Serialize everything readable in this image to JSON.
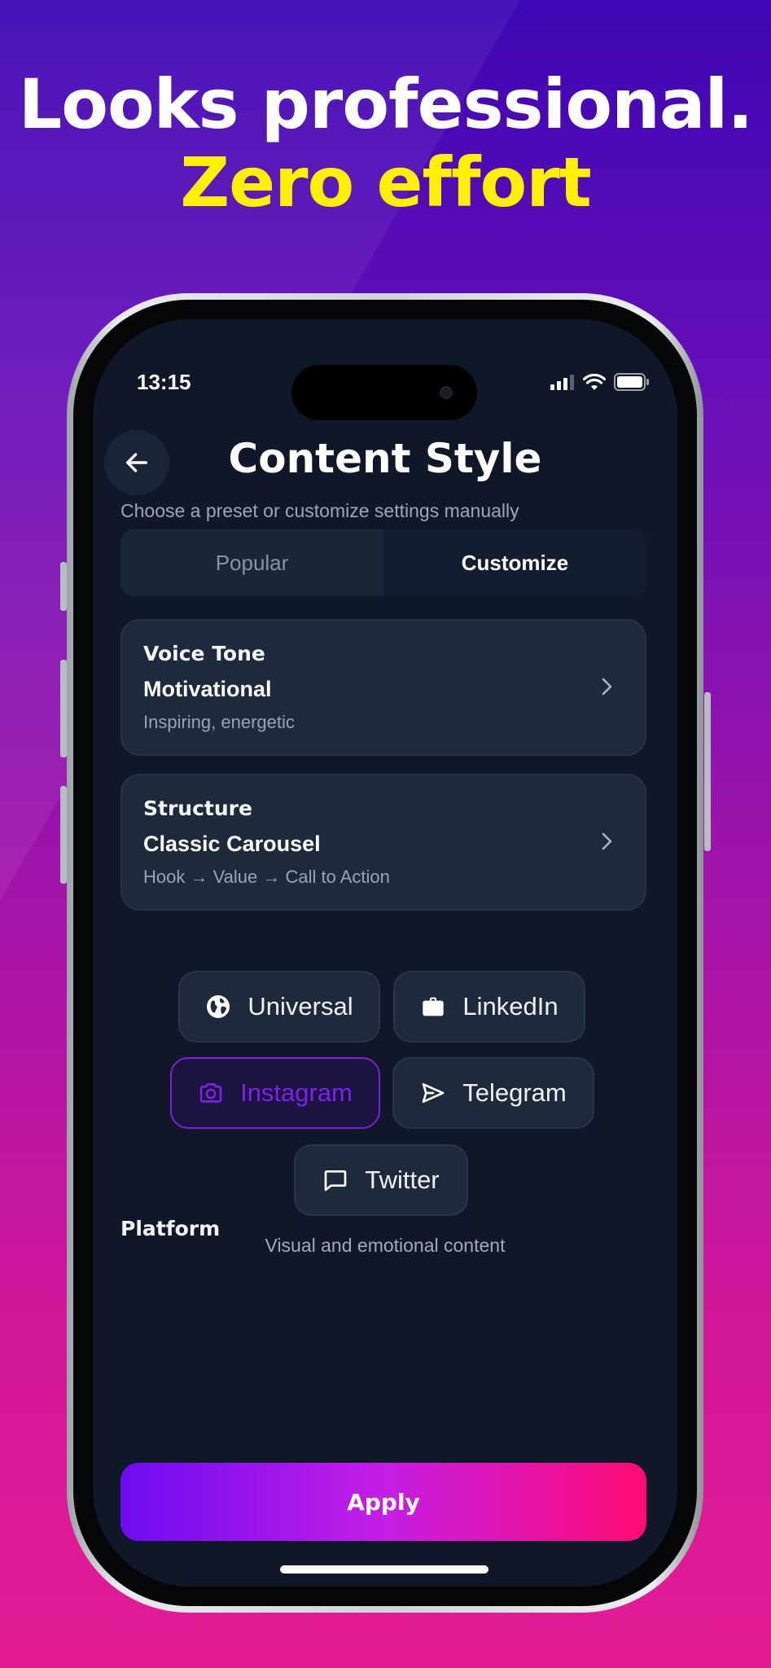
{
  "headline": {
    "line1": "Looks professional.",
    "line2": "Zero effort"
  },
  "status_bar": {
    "time": "13:15"
  },
  "header": {
    "title": "Content Style",
    "subtitle": "Choose a preset or customize settings manually"
  },
  "tabs": [
    {
      "label": "Popular",
      "active": false
    },
    {
      "label": "Customize",
      "active": true
    }
  ],
  "voice_tone": {
    "title": "Voice Tone",
    "value": "Motivational",
    "description": "Inspiring, energetic"
  },
  "structure": {
    "title": "Structure",
    "value": "Classic Carousel",
    "description": "Hook → Value → Call to Action"
  },
  "platform": {
    "label": "Platform",
    "options": [
      {
        "label": "Universal",
        "icon": "globe-icon",
        "selected": false
      },
      {
        "label": "LinkedIn",
        "icon": "briefcase-icon",
        "selected": false
      },
      {
        "label": "Instagram",
        "icon": "camera-icon",
        "selected": true
      },
      {
        "label": "Telegram",
        "icon": "send-icon",
        "selected": false
      },
      {
        "label": "Twitter",
        "icon": "message-square-icon",
        "selected": false
      }
    ],
    "helper": "Visual and emotional content"
  },
  "apply_label": "Apply",
  "colors": {
    "headline_accent": "#ffef00",
    "selected_chip": "#7d22e6",
    "screen_bg": "#0f1729",
    "apply_gradient_start": "#6d0cf0",
    "apply_gradient_end": "#ff0b72"
  }
}
